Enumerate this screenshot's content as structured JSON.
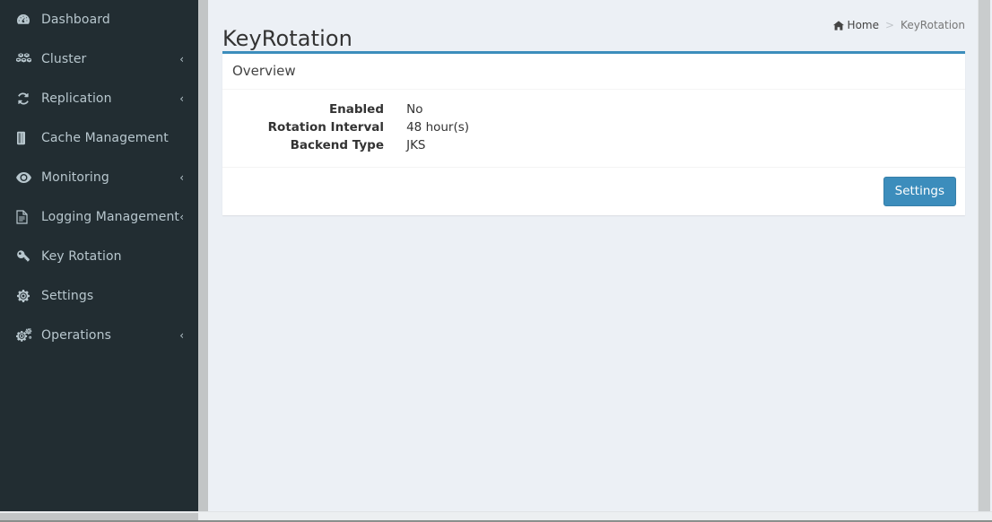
{
  "sidebar": {
    "items": [
      {
        "label": "Dashboard",
        "icon": "dashboard-icon",
        "arrow": ""
      },
      {
        "label": "Cluster",
        "icon": "cubes-icon",
        "arrow": "‹"
      },
      {
        "label": "Replication",
        "icon": "refresh-icon",
        "arrow": "‹"
      },
      {
        "label": "Cache Management",
        "icon": "database-icon",
        "arrow": ""
      },
      {
        "label": "Monitoring",
        "icon": "eye-icon",
        "arrow": "‹"
      },
      {
        "label": "Logging Management",
        "icon": "file-text-icon",
        "arrow": "‹"
      },
      {
        "label": "Key Rotation",
        "icon": "key-icon",
        "arrow": ""
      },
      {
        "label": "Settings",
        "icon": "gear-icon",
        "arrow": ""
      },
      {
        "label": "Operations",
        "icon": "gears-icon",
        "arrow": "‹"
      }
    ]
  },
  "header": {
    "title": "KeyRotation",
    "breadcrumb": {
      "home_label": "Home",
      "separator": ">",
      "current": "KeyRotation"
    }
  },
  "overview": {
    "box_title": "Overview",
    "fields": [
      {
        "label": "Enabled",
        "value": "No"
      },
      {
        "label": "Rotation Interval",
        "value": "48 hour(s)"
      },
      {
        "label": "Backend Type",
        "value": "JKS"
      }
    ],
    "settings_button": "Settings"
  },
  "colors": {
    "sidebar_bg": "#222d32",
    "sidebar_text": "#b8c7ce",
    "page_bg": "#ecf0f5",
    "accent": "#3c8dbc",
    "panel_bg": "#ffffff",
    "title_text": "#333333"
  }
}
